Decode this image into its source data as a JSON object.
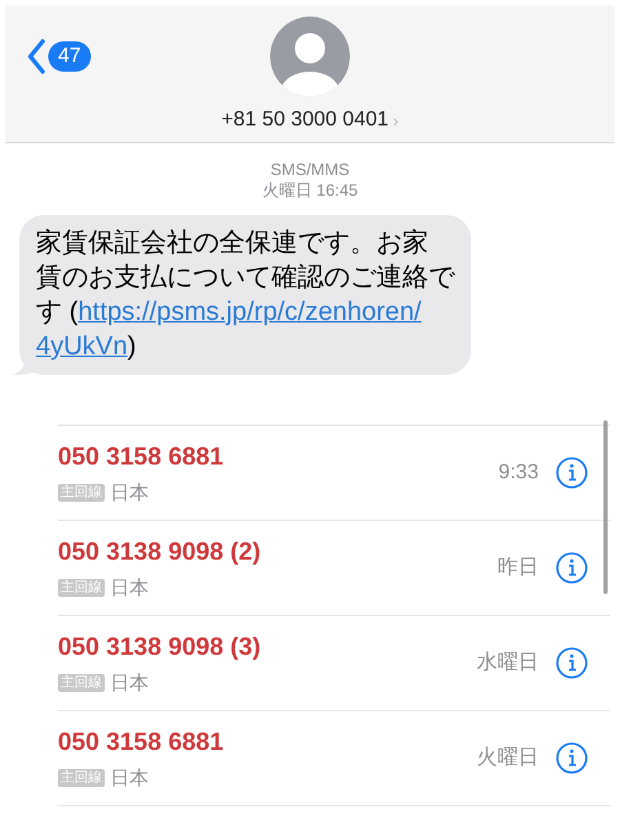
{
  "header": {
    "back_count": "47",
    "contact": "+81 50 3000 0401",
    "chevron": "›"
  },
  "thread": {
    "service": "SMS/MMS",
    "timestamp": "火曜日 16:45"
  },
  "message": {
    "lines": [
      "家賃保証会社の全保連です。お家",
      "賃のお支払について確認のご連絡で"
    ],
    "text_before": "す (",
    "link_lines": [
      "https://psms.jp/rp/c/zenhoren/",
      "4yUkVn"
    ],
    "text_after": ")"
  },
  "calls": [
    {
      "number": "050 3158 6881",
      "missed": true,
      "line": "主回線",
      "location": "日本",
      "time": "9:33"
    },
    {
      "number": "050 3138 9098 (2)",
      "missed": true,
      "line": "主回線",
      "location": "日本",
      "time": "昨日"
    },
    {
      "number": "050 3138 9098 (3)",
      "missed": true,
      "line": "主回線",
      "location": "日本",
      "time": "水曜日"
    },
    {
      "number": "050 3158 6881",
      "missed": true,
      "line": "主回線",
      "location": "日本",
      "time": "火曜日"
    }
  ]
}
